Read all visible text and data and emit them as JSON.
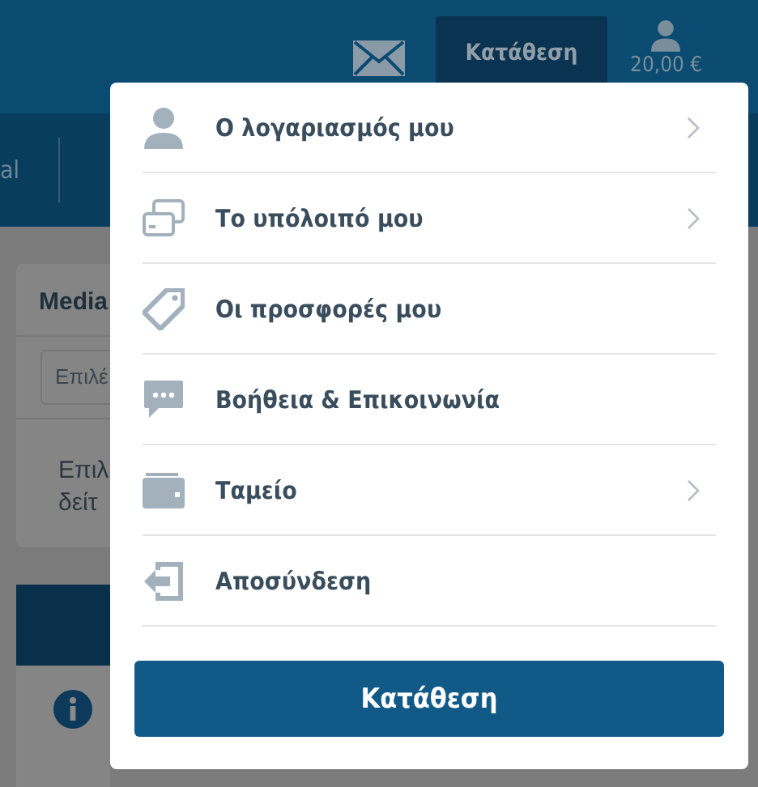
{
  "header": {
    "deposit_button": "Κατάθεση",
    "balance": "20,00 €"
  },
  "nav": {
    "label": "al"
  },
  "card": {
    "title": "Media",
    "select_placeholder": "Επιλέ",
    "text_lines": [
      "Επιλ",
      "δείτ"
    ]
  },
  "menu": {
    "items": [
      {
        "kind": "account",
        "label": "Ο λογαριασμός μου",
        "submenu": true
      },
      {
        "kind": "balance",
        "label": "Το υπόλοιπό μου",
        "submenu": true
      },
      {
        "kind": "offers",
        "label": "Οι προσφορές μου",
        "submenu": false
      },
      {
        "kind": "help",
        "label": "Βοήθεια & Επικοινωνία",
        "submenu": false
      },
      {
        "kind": "cashier",
        "label": "Ταμείο",
        "submenu": true
      },
      {
        "kind": "logout",
        "label": "Αποσύνδεση",
        "submenu": false
      }
    ],
    "button": "Κατάθεση"
  }
}
